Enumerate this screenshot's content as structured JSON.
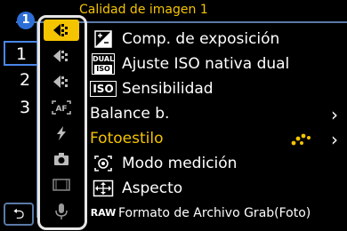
{
  "header": {
    "title": "Calidad de imagen 1"
  },
  "colors": {
    "accent": "#f5c400",
    "frame": "#5a79a8",
    "badge": "#2d6fd6"
  },
  "badge": {
    "label": "1"
  },
  "pages": [
    "1",
    "2",
    "3"
  ],
  "back_label": "⮌",
  "tabs": [
    {
      "icon": "camera-image-quality-icon",
      "active": true
    },
    {
      "icon": "camera-focus-icon",
      "active": false
    },
    {
      "icon": "camera-file-icon",
      "active": false
    },
    {
      "icon": "af-icon",
      "active": false
    },
    {
      "icon": "flash-icon",
      "active": false
    },
    {
      "icon": "camera-others-icon",
      "active": false
    },
    {
      "icon": "video-icon",
      "active": false
    },
    {
      "icon": "microphone-icon",
      "active": false
    }
  ],
  "menu": {
    "items": [
      {
        "label": "Comp. de exposición",
        "icon": "exposure-comp-icon"
      },
      {
        "label": "Ajuste ISO nativa dual",
        "icon": "dual-iso-icon",
        "icon_text_top": "DUAL",
        "icon_text_bottom": "ISO"
      },
      {
        "label": "Sensibilidad",
        "icon": "iso-icon",
        "icon_text": "ISO"
      },
      {
        "label": "Balance b.",
        "chevron": "›"
      },
      {
        "label": "Fotoestilo",
        "selected": true,
        "chevron": "›"
      },
      {
        "label": "Modo medición",
        "icon": "metering-icon"
      },
      {
        "label": "Aspecto",
        "icon": "aspect-icon"
      },
      {
        "label": "Formato de Archivo Grab(Foto)",
        "icon": "raw-icon",
        "icon_text": "RAW"
      }
    ]
  }
}
